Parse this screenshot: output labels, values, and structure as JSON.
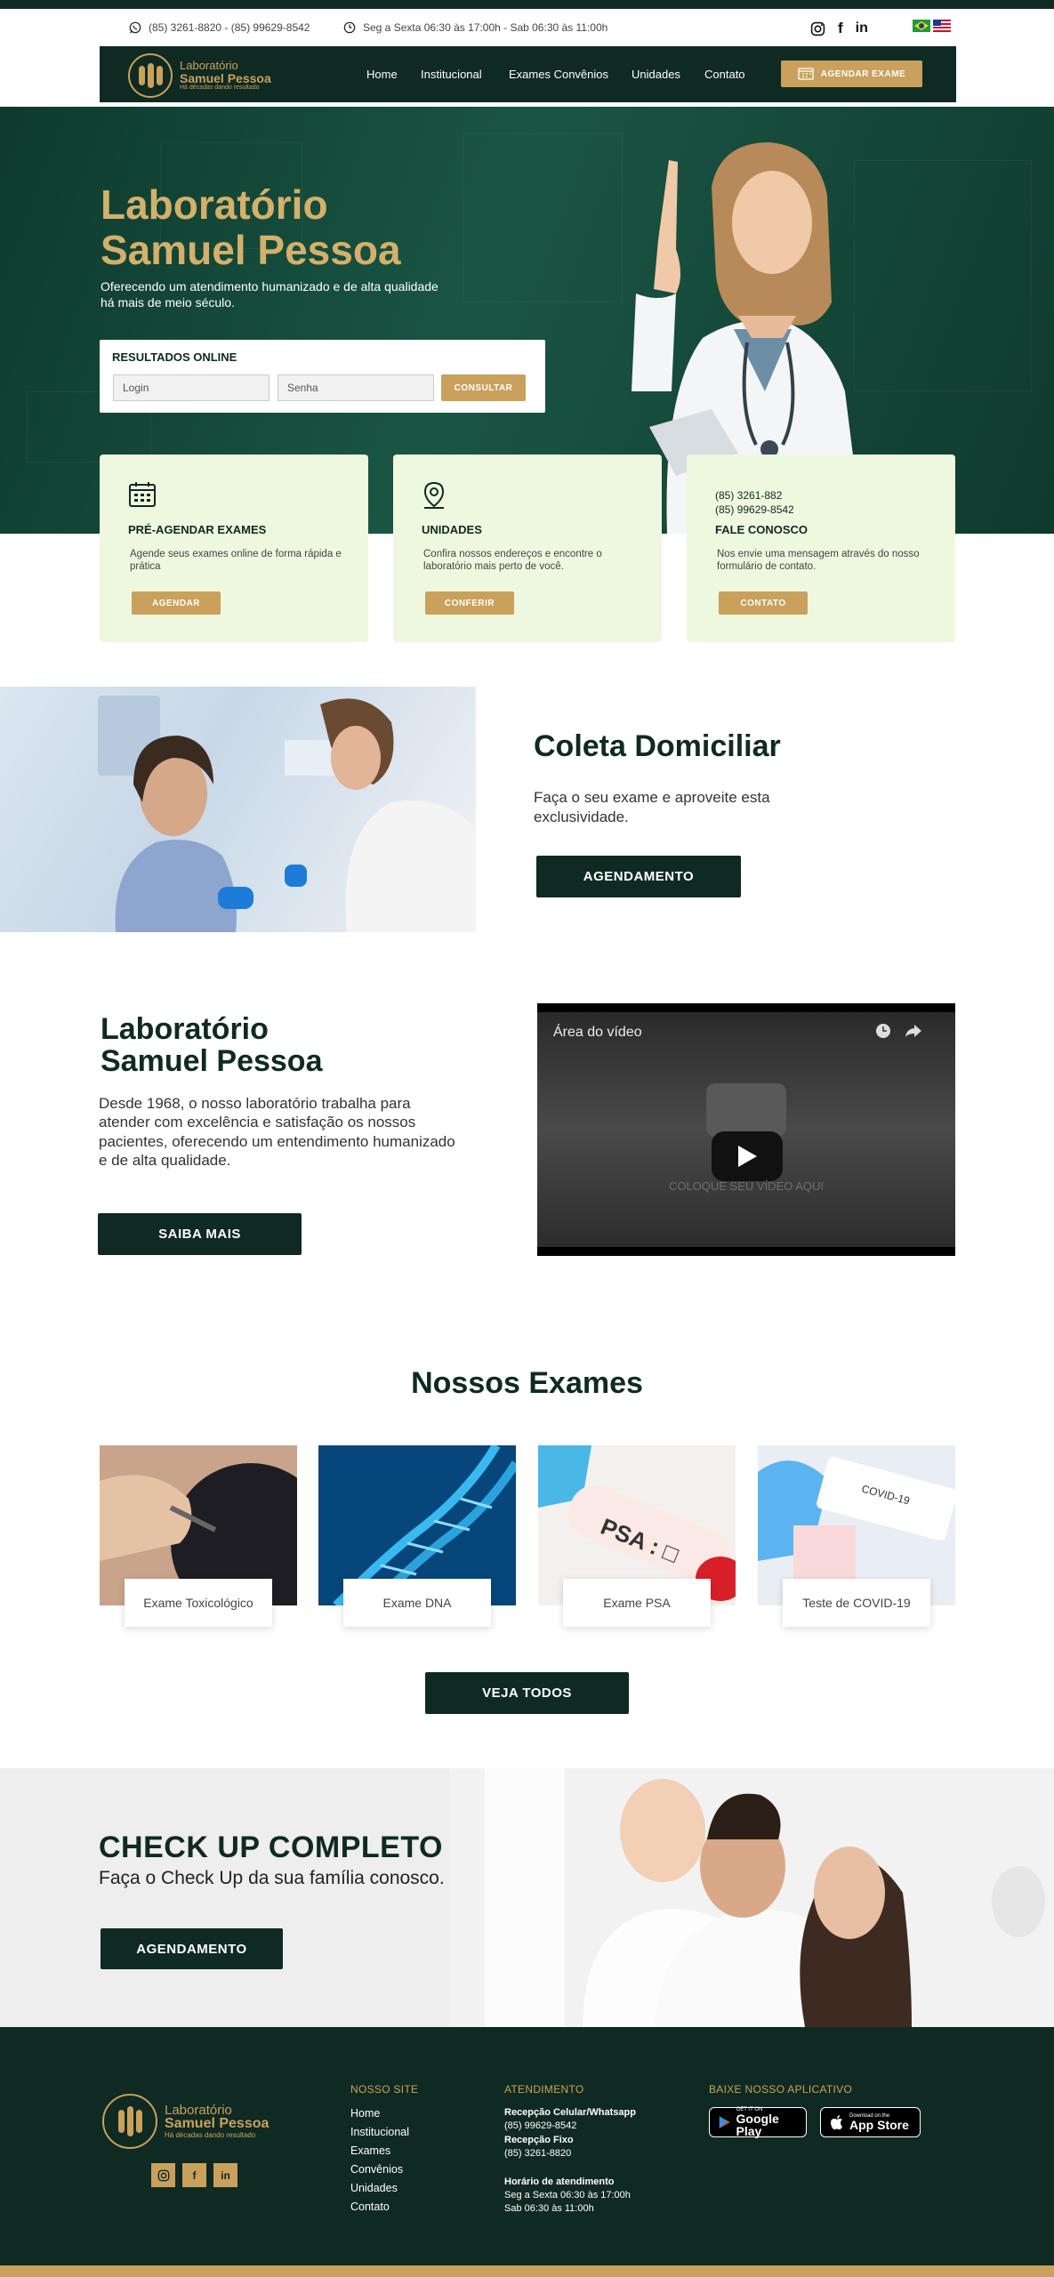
{
  "topbar": {
    "phones": "(85) 3261-8820 - (85) 99629-8542",
    "hours": "Seg a Sexta 06:30 às 17:00h - Sab 06:30 às 11:00h"
  },
  "brand": {
    "line1": "Laboratório",
    "line2": "Samuel Pessoa",
    "tagline": "Há décadas dando resultado"
  },
  "nav": {
    "items": [
      "Home",
      "Institucional",
      "Exames Convênios",
      "Unidades",
      "Contato"
    ],
    "cta": "AGENDAR EXAME"
  },
  "hero": {
    "title_line1": "Laboratório",
    "title_line2": "Samuel Pessoa",
    "subtitle": "Oferecendo um atendimento humanizado e de alta qualidade há mais de meio século.",
    "results": {
      "title": "RESULTADOS ONLINE",
      "login_placeholder": "Login",
      "password_placeholder": "Senha",
      "button": "CONSULTAR"
    }
  },
  "cards": [
    {
      "title": "PRÉ-AGENDAR EXAMES",
      "desc": "Agende seus exames online de forma rápida e prática",
      "button": "AGENDAR",
      "icon": "calendar-icon"
    },
    {
      "title": "UNIDADES",
      "desc": "Confira nossos endereços e encontre o laboratório mais perto de você.",
      "button": "CONFERIR",
      "icon": "location-pin-icon"
    },
    {
      "title": "FALE CONOSCO",
      "phone1": "(85) 3261-882",
      "phone2": "(85) 99629-8542",
      "desc": "Nos envie uma mensagem através do nosso formulário de contato.",
      "button": "CONTATO"
    }
  ],
  "coleta": {
    "title": "Coleta Domiciliar",
    "subtitle": "Faça o seu exame e aproveite esta exclusividade.",
    "button": "AGENDAMENTO"
  },
  "about": {
    "title_line1": "Laboratório",
    "title_line2": "Samuel Pessoa",
    "text": "Desde 1968, o nosso laboratório trabalha para atender com excelência e satisfação os nossos pacientes, oferecendo um entendimento humanizado e de alta qualidade.",
    "button": "SAIBA MAIS"
  },
  "video": {
    "title": "Área do vídeo",
    "placeholder": "COLOQUE SEU VÍDEO AQUI"
  },
  "exams": {
    "title": "Nossos Exames",
    "items": [
      "Exame Toxicológico",
      "Exame DNA",
      "Exame PSA",
      "Teste de COVID-19"
    ],
    "button": "VEJA TODOS"
  },
  "checkup": {
    "title": "CHECK UP COMPLETO",
    "subtitle": "Faça o Check Up da sua família conosco.",
    "button": "AGENDAMENTO"
  },
  "footer": {
    "site_title": "NOSSO SITE",
    "site_links": [
      "Home",
      "Institucional",
      "Exames",
      "Convênios",
      "Unidades",
      "Contato"
    ],
    "atend_title": "ATENDIMENTO",
    "cel_label": "Recepção Celular/Whatsapp",
    "cel_value": "(85) 99629-8542",
    "fixo_label": "Recepção Fixo",
    "fixo_value": "(85) 3261-8820",
    "hours_label": "Horário de atendimento",
    "hours_line1": "Seg a Sexta 06:30 às 17:00h",
    "hours_line2": "Sab 06:30 às 11:00h",
    "app_title": "BAIXE NOSSO APLICATIVO",
    "google_small": "GET IT ON",
    "google_big": "Google Play",
    "apple_small": "Download on the",
    "apple_big": "App Store"
  },
  "colors": {
    "primary": "#0f2a22",
    "accent": "#c9a15c",
    "card_bg": "#eef8df"
  }
}
